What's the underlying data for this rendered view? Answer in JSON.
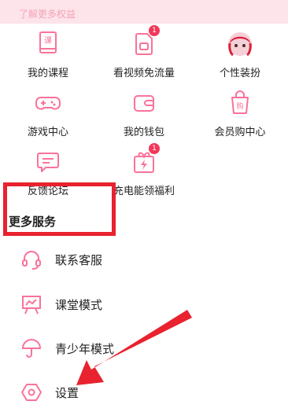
{
  "banner": {
    "subtitle": "了解更多权益"
  },
  "grid": [
    {
      "label": "我的课程",
      "icon": "course-book-icon",
      "badge": ""
    },
    {
      "label": "看视频免流量",
      "icon": "video-sim-icon",
      "badge": "1"
    },
    {
      "label": "个性装扮",
      "icon": "avatar-dress-icon",
      "badge": ""
    },
    {
      "label": "游戏中心",
      "icon": "gamepad-icon",
      "badge": ""
    },
    {
      "label": "我的钱包",
      "icon": "wallet-icon",
      "badge": ""
    },
    {
      "label": "会员购中心",
      "icon": "shopping-bag-icon",
      "badge": ""
    },
    {
      "label": "反馈论坛",
      "icon": "feedback-chat-icon",
      "badge": ""
    },
    {
      "label": "充电能领福利",
      "icon": "gift-bolt-icon",
      "badge": "1"
    }
  ],
  "section": {
    "title": "更多服务"
  },
  "list": [
    {
      "label": "联系客服",
      "icon": "headset-icon"
    },
    {
      "label": "课堂模式",
      "icon": "classroom-board-icon"
    },
    {
      "label": "青少年模式",
      "icon": "umbrella-icon"
    },
    {
      "label": "设置",
      "icon": "settings-hex-icon"
    }
  ],
  "colors": {
    "accent": "#fb7299",
    "annotation": "#e8222e",
    "banner_bg": "#fde3ea"
  }
}
